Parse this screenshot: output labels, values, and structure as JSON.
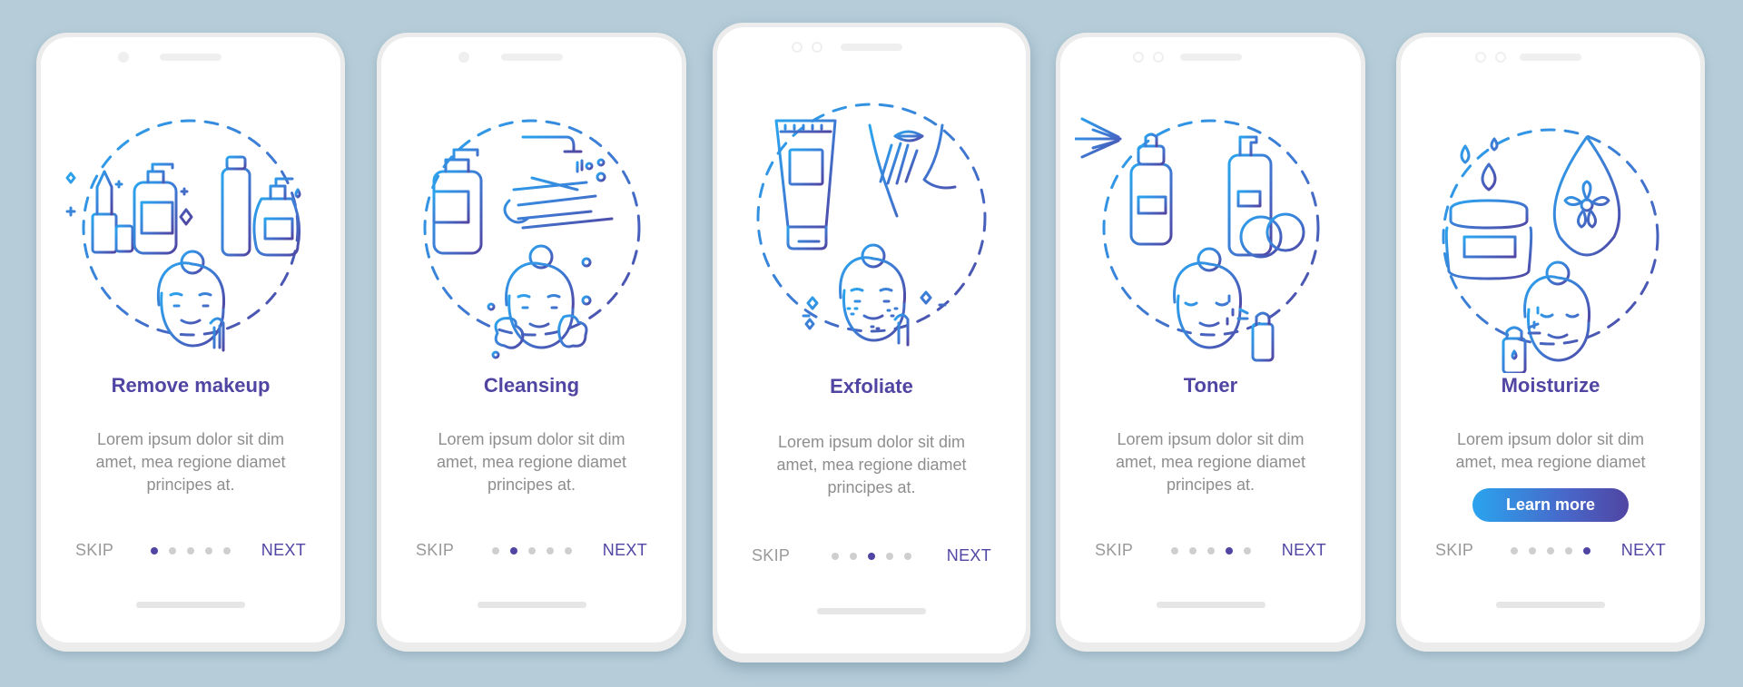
{
  "colors": {
    "background": "#b6cdd9",
    "title": "#5045a2",
    "body_text": "#8e8e8e",
    "skip": "#999999",
    "next": "#5045a2",
    "dot_inactive": "#cfcfcf",
    "dot_active": "#5045a2",
    "gradient_start": "#2aa4ee",
    "gradient_end": "#5045a2"
  },
  "screens": [
    {
      "title": "Remove makeup",
      "body": [
        "Lorem ipsum dolor sit dim",
        "amet, mea regione diamet",
        "principes at."
      ],
      "illustration": [
        "lipstick-icon",
        "pump-bottle-icon",
        "toner-bottle-icon",
        "soap-dispenser-icon",
        "sparkle-icon",
        "woman-face-icon",
        "cotton-pad-hand-icon"
      ],
      "skip_label": "SKIP",
      "next_label": "NEXT",
      "active_step": 1,
      "total_steps": 5
    },
    {
      "title": "Cleansing",
      "body": [
        "Lorem ipsum dolor sit dim",
        "amet, mea regione diamet",
        "principes at."
      ],
      "illustration": [
        "pump-bottle-icon",
        "faucet-icon",
        "washing-hands-icon",
        "bubbles-icon",
        "woman-face-foam-icon"
      ],
      "skip_label": "SKIP",
      "next_label": "NEXT",
      "active_step": 2,
      "total_steps": 5
    },
    {
      "title": "Exfoliate",
      "body": [
        "Lorem ipsum dolor sit dim",
        "amet, mea regione diamet",
        "principes at."
      ],
      "illustration": [
        "scrub-tube-icon",
        "lip-scrub-hand-icon",
        "sparkle-icon",
        "woman-face-scrub-icon"
      ],
      "skip_label": "SKIP",
      "next_label": "NEXT",
      "active_step": 3,
      "total_steps": 5
    },
    {
      "title": "Toner",
      "body": [
        "Lorem ipsum dolor sit dim",
        "amet, mea regione diamet",
        "principes at."
      ],
      "illustration": [
        "spray-bottle-icon",
        "toner-bottle-icon",
        "cotton-pads-icon",
        "woman-face-spray-icon",
        "mist-bottle-icon"
      ],
      "skip_label": "SKIP",
      "next_label": "NEXT",
      "active_step": 4,
      "total_steps": 5
    },
    {
      "title": "Moisturize",
      "body": [
        "Lorem ipsum dolor sit dim",
        "amet, mea regione diamet"
      ],
      "illustration": [
        "cream-jar-icon",
        "water-drops-icon",
        "flower-drop-icon",
        "woman-face-mist-icon",
        "mist-bottle-icon"
      ],
      "button_label": "Learn more",
      "skip_label": "SKIP",
      "next_label": "NEXT",
      "active_step": 5,
      "total_steps": 5
    }
  ]
}
